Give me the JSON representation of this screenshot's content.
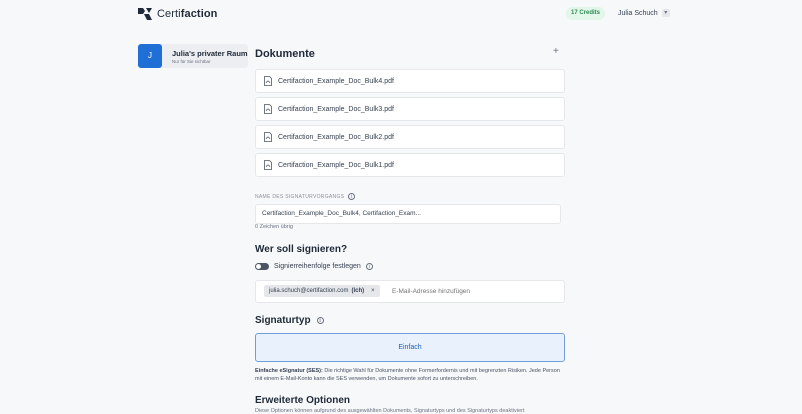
{
  "header": {
    "brand_prefix": "Certi",
    "brand_suffix": "faction",
    "credits": "17 Credits",
    "user_name": "Julia Schuch"
  },
  "space": {
    "avatar": "J",
    "title": "Julia's privater Raum",
    "subtitle": "Nur für Sie sichtbar"
  },
  "documents": {
    "heading": "Dokumente",
    "add": "+",
    "items": [
      "Certifaction_Example_Doc_Bulk4.pdf",
      "Certifaction_Example_Doc_Bulk3.pdf",
      "Certifaction_Example_Doc_Bulk2.pdf",
      "Certifaction_Example_Doc_Bulk1.pdf"
    ]
  },
  "process": {
    "label": "NAME DES SIGNATURVORGANGS",
    "value": "Certifaction_Example_Doc_Bulk4, Certifaction_Exam...",
    "chars_left": "0 Zeichen übrig"
  },
  "signers": {
    "heading": "Wer soll signieren?",
    "order_toggle_label": "Signierreihenfolge festlegen",
    "chip_email": "julia.schuch@certifaction.com",
    "chip_tag": "(Ich)",
    "chip_remove": "×",
    "email_placeholder": "E-Mail-Adresse hinzufügen"
  },
  "signature": {
    "heading": "Signaturtyp",
    "option": "Einfach",
    "desc_bold": "Einfache eSignatur (SES):",
    "desc_text": " Die richtige Wahl für Dokumente ohne Formerfordernis und mit begrenzten Risiken. Jede Person mit einem E-Mail-Konto kann die SES verwenden, um Dokumente sofort zu unterschreiben."
  },
  "advanced": {
    "heading": "Erweiterte Optionen",
    "desc": "Diese Optionen können aufgrund des ausgewählten Dokuments, Signaturtyps und des Signaturtyps deaktiviert"
  },
  "colors": {
    "accent": "#1f6fd6",
    "credits_bg": "#e3f6ea",
    "credits_fg": "#2e8a55",
    "option_bg": "#e9f2fc",
    "option_border": "#6e9fd8"
  }
}
